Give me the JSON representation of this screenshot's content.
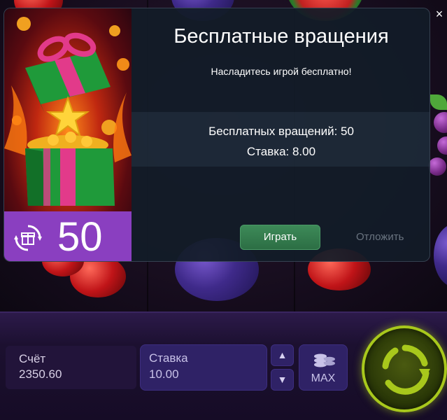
{
  "modal": {
    "title": "Бесплатные вращения",
    "subtitle": "Насладитесь игрой бесплатно!",
    "spins_line": "Бесплатных вращений: 50",
    "stake_line": "Ставка: 8.00",
    "play_label": "Играть",
    "postpone_label": "Отложить",
    "close_symbol": "×",
    "promo_count": "50",
    "promo_icon": "gift-spin-icon"
  },
  "bottom_bar": {
    "balance_label": "Счёт",
    "balance_value": "2350.60",
    "bet_label": "Ставка",
    "bet_value": "10.00",
    "bet_up_symbol": "▲",
    "bet_down_symbol": "▼",
    "max_label": "MAX",
    "max_icon": "coin-stack-icon",
    "spin_icon": "spin-arrows-icon"
  },
  "colors": {
    "play_button": "#2c6e44",
    "promo_counter_bg": "#8a3fc0",
    "spin_ring": "#a8c81c",
    "bet_panel": "#2f2266"
  }
}
